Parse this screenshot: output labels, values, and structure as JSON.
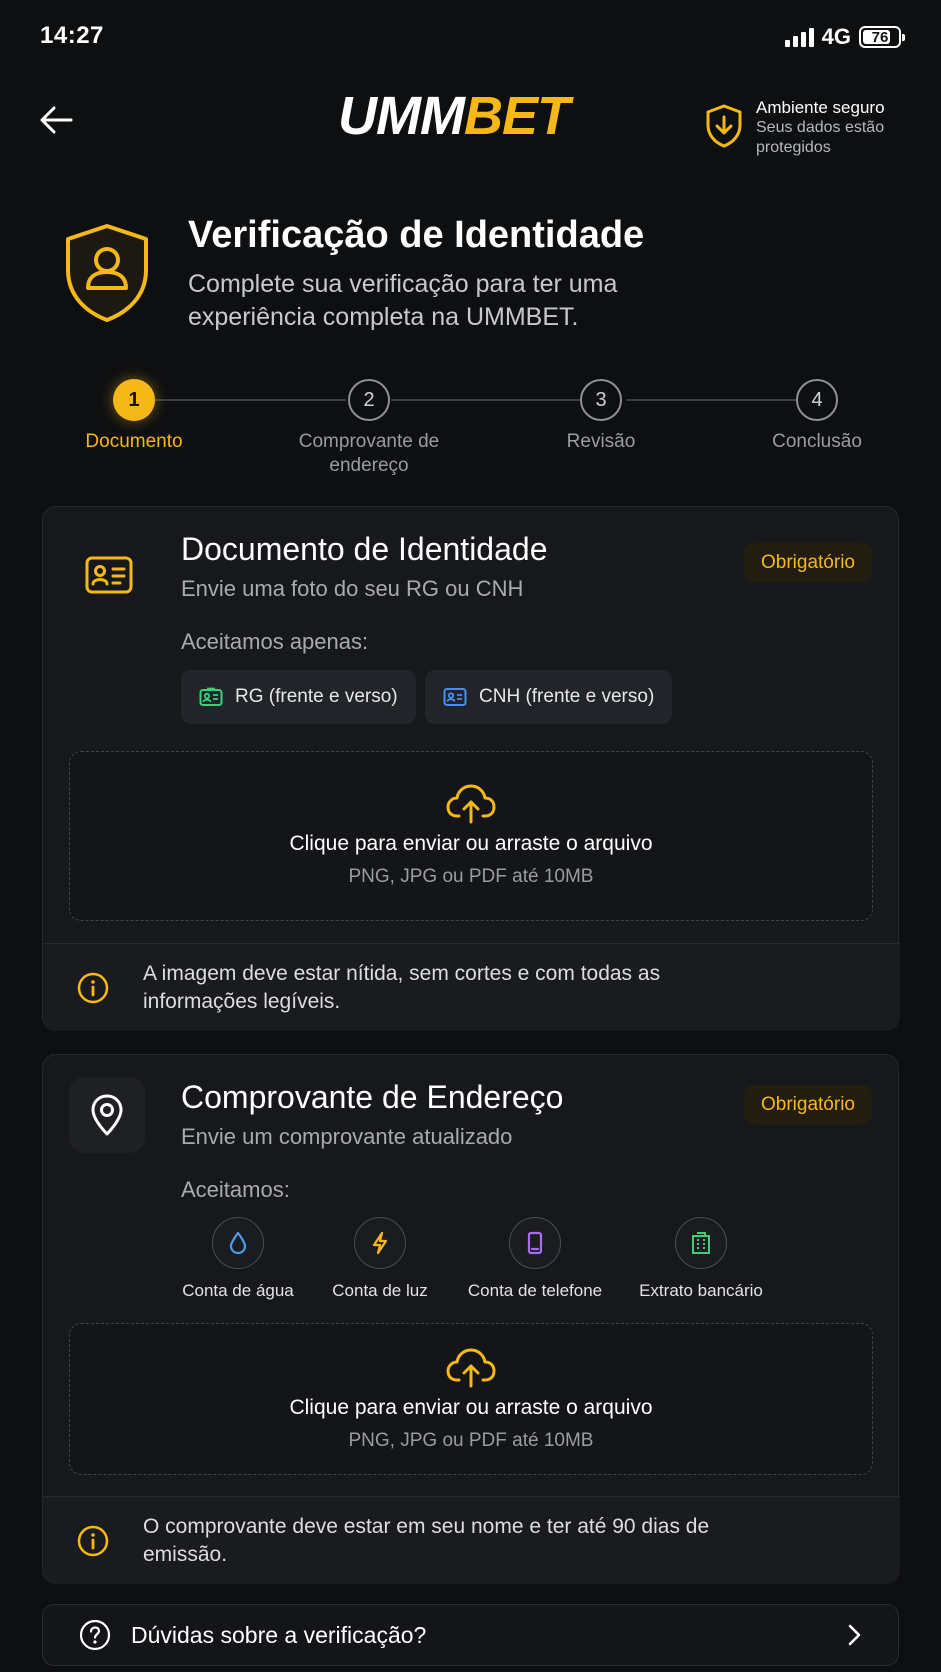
{
  "status_bar": {
    "time": "14:27",
    "network": "4G",
    "battery": "76"
  },
  "header": {
    "logo_white": "UMM",
    "logo_yellow": "BET",
    "secure_title": "Ambiente seguro",
    "secure_subtitle": "Seus dados estão protegidos"
  },
  "hero": {
    "title": "Verificação de Identidade",
    "subtitle": "Complete sua verificação para ter uma experiência completa na UMMBET."
  },
  "stepper": [
    {
      "number": "1",
      "label": "Documento",
      "active": true
    },
    {
      "number": "2",
      "label": "Comprovante de endereço",
      "active": false
    },
    {
      "number": "3",
      "label": "Revisão",
      "active": false
    },
    {
      "number": "4",
      "label": "Conclusão",
      "active": false
    }
  ],
  "identity_card": {
    "title": "Documento de Identidade",
    "subtitle": "Envie uma foto do seu RG ou CNH",
    "badge": "Obrigatório",
    "accepted_label": "Aceitamos apenas:",
    "accepted": [
      {
        "label": "RG (frente e verso)",
        "icon": "id-card-icon",
        "color": "#3ecf7a"
      },
      {
        "label": "CNH (frente e verso)",
        "icon": "license-icon",
        "color": "#4a8ef2"
      }
    ],
    "upload_title": "Clique para enviar ou arraste o arquivo",
    "upload_subtitle": "PNG, JPG ou PDF até 10MB",
    "note": "A imagem deve estar nítida, sem cortes e com todas as informações legíveis."
  },
  "address_card": {
    "title": "Comprovante de Endereço",
    "subtitle": "Envie um comprovante atualizado",
    "badge": "Obrigatório",
    "accepted_label": "Aceitamos:",
    "accepted": [
      {
        "label": "Conta de água",
        "icon": "water-drop-icon",
        "color": "#4a9ef2"
      },
      {
        "label": "Conta de luz",
        "icon": "lightning-icon",
        "color": "#f6b817"
      },
      {
        "label": "Conta de telefone",
        "icon": "phone-icon",
        "color": "#a66cf2"
      },
      {
        "label": "Extrato bancário",
        "icon": "bank-icon",
        "color": "#3ecf7a"
      }
    ],
    "upload_title": "Clique para enviar ou arraste o arquivo",
    "upload_subtitle": "PNG, JPG ou PDF até 10MB",
    "note": "O comprovante deve estar em seu nome e ter até 90 dias de emissão."
  },
  "help": {
    "label": "Dúvidas sobre a verificação?"
  },
  "colors": {
    "accent": "#f6b817",
    "background": "#0e0f11",
    "card": "#17181c"
  }
}
